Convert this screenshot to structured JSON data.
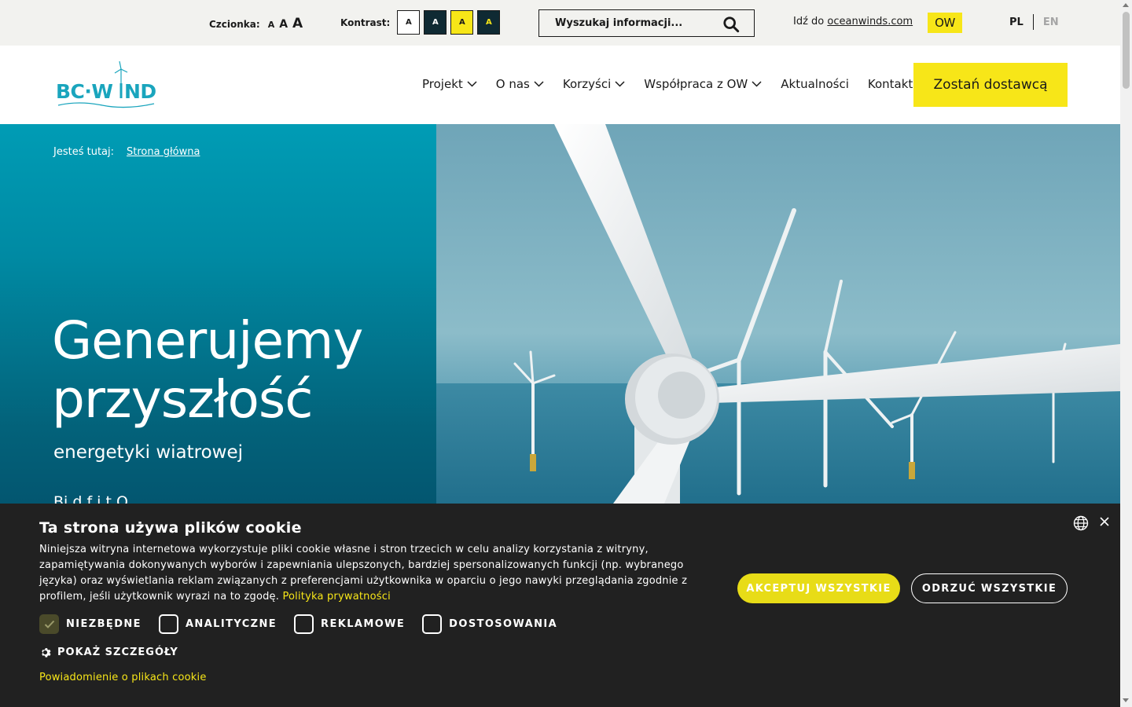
{
  "utility": {
    "font_label": "Czcionka:",
    "font_sizes": [
      "A",
      "A",
      "A"
    ],
    "contrast_label": "Kontrast:",
    "contrast_options": [
      "A",
      "A",
      "A",
      "A"
    ],
    "search_placeholder": "Wyszukaj informacji...",
    "goto_prefix": "Idź do",
    "goto_link": "oceanwinds.com",
    "ow_logo": "OW",
    "languages": [
      "PL",
      "EN"
    ],
    "active_language": "PL"
  },
  "header": {
    "logo_text": "BC·WIND",
    "nav": [
      {
        "label": "Projekt",
        "has_dropdown": true
      },
      {
        "label": "O nas",
        "has_dropdown": true
      },
      {
        "label": "Korzyści",
        "has_dropdown": true
      },
      {
        "label": "Współpraca z OW",
        "has_dropdown": true
      },
      {
        "label": "Aktualności",
        "has_dropdown": false
      },
      {
        "label": "Kontakt",
        "has_dropdown": false
      }
    ],
    "cta_label": "Zostań dostawcą"
  },
  "hero": {
    "breadcrumb_label": "Jesteś tutaj:",
    "breadcrumb_link": "Strona główna",
    "title_line1": "Generujemy",
    "title_line2": "przyszłość",
    "subtitle": "energetyki wiatrowej",
    "description_partial": "Bi                    d  f          i t        O"
  },
  "cookie": {
    "title": "Ta strona używa plików cookie",
    "text": "Niniejsza witryna internetowa wykorzystuje pliki cookie własne i stron trzecich w celu analizy korzystania z witryny, zapamiętywania dokonywanych wyborów i zapewniania ulepszonych, bardziej spersonalizowanych funkcji (np. wybranego języka) oraz wyświetlania reklam związanych z preferencjami użytkownika w oparciu o jego nawyki przeglądania zgodnie z profilem, jeśli użytkownik wyrazi na to zgodę.",
    "policy_link": "Polityka prywatności",
    "categories": [
      {
        "label": "NIEZBĘDNE",
        "checked": true
      },
      {
        "label": "ANALITYCZNE",
        "checked": false
      },
      {
        "label": "REKLAMOWE",
        "checked": false
      },
      {
        "label": "DOSTOSOWANIA",
        "checked": false
      }
    ],
    "details_label": "POKAŻ SZCZEGÓŁY",
    "notice_link": "Powiadomienie o plikach cookie",
    "accept_label": "AKCEPTUJ WSZYSTKIE",
    "reject_label": "ODRZUĆ WSZYSTKIE"
  },
  "colors": {
    "brand_yellow": "#f7e618",
    "brand_teal": "#009cb5",
    "dark_navy": "#0f2a33",
    "cookie_bg": "#212121"
  },
  "icons": [
    "search-icon",
    "chevron-down-icon",
    "globe-icon",
    "close-icon",
    "gear-icon",
    "checkmark-icon"
  ]
}
